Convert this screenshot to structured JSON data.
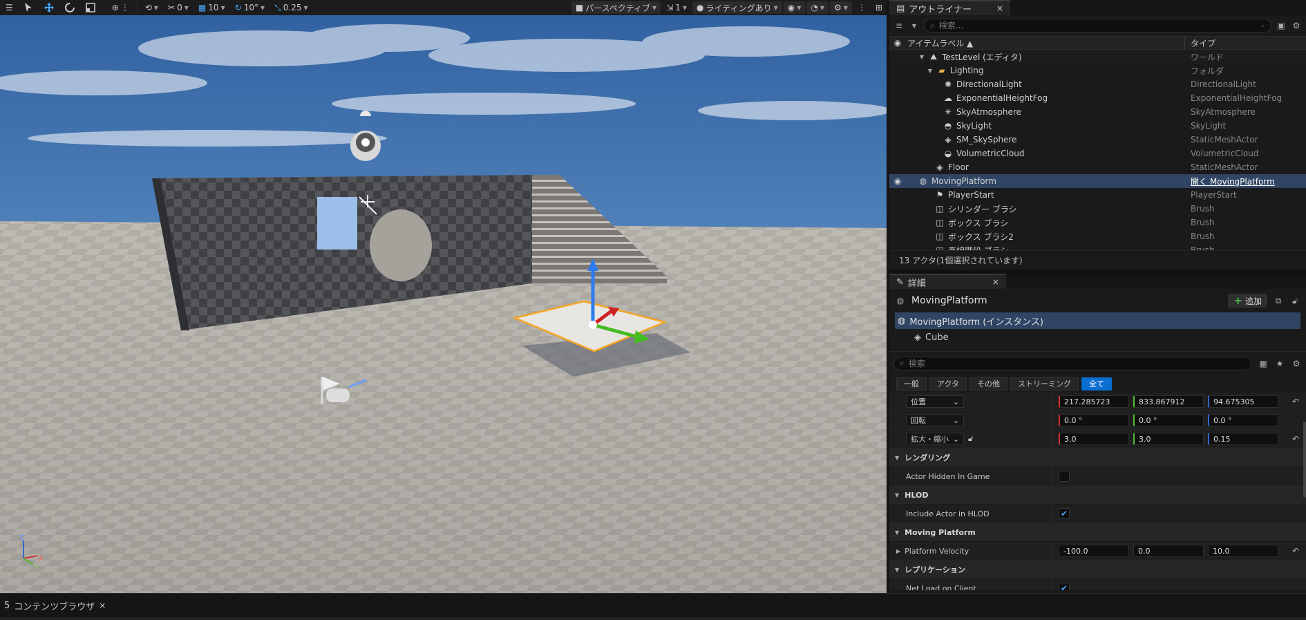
{
  "toolbar": {
    "snap_rotate_value": "0",
    "grid_snap_value": "10",
    "rotation_snap_value": "10°",
    "scale_snap_value": "0.25",
    "perspective_label": "パースペクティブ",
    "camera_speed_value": "1",
    "lighting_label": "ライティングあり"
  },
  "bottom": {
    "content_browser_label": "コンテンツブラウザ",
    "content_browser_prefix": "5",
    "close_glyph": "×"
  },
  "outliner": {
    "tab_label": "アウトライナー",
    "close_glyph": "×",
    "search_placeholder": "検索...",
    "header_label": "アイテムラベル ▲",
    "header_type": "タイプ",
    "rows": [
      {
        "label": "TestLevel (エディタ)",
        "type": "ワールド"
      },
      {
        "label": "Lighting",
        "type": "フォルダ"
      },
      {
        "label": "DirectionalLight",
        "type": "DirectionalLight"
      },
      {
        "label": "ExponentialHeightFog",
        "type": "ExponentialHeightFog"
      },
      {
        "label": "SkyAtmosphere",
        "type": "SkyAtmosphere"
      },
      {
        "label": "SkyLight",
        "type": "SkyLight"
      },
      {
        "label": "SM_SkySphere",
        "type": "StaticMeshActor"
      },
      {
        "label": "VolumetricCloud",
        "type": "VolumetricCloud"
      },
      {
        "label": "Floor",
        "type": "StaticMeshActor"
      },
      {
        "label": "MovingPlatform",
        "type": "開く MovingPlatform"
      },
      {
        "label": "PlayerStart",
        "type": "PlayerStart"
      },
      {
        "label": "シリンダー ブラシ",
        "type": "Brush"
      },
      {
        "label": "ボックス ブラシ",
        "type": "Brush"
      },
      {
        "label": "ボックス ブラシ2",
        "type": "Brush"
      },
      {
        "label": "直線階段 ブラシ",
        "type": "Brush"
      }
    ],
    "status": "13 アクタ(1個選択されています)"
  },
  "details": {
    "tab_label": "詳細",
    "close_glyph": "×",
    "actor_name": "MovingPlatform",
    "add_label": "追加",
    "instance_label": "MovingPlatform (インスタンス)",
    "component_cube": "Cube",
    "search_placeholder": "検索",
    "filters": [
      "一般",
      "アクタ",
      "その他",
      "ストリーミング",
      "全て"
    ],
    "location_label": "位置",
    "location": [
      "217.285723",
      "833.867912",
      "94.675305"
    ],
    "rotation_label": "回転",
    "rotation": [
      "0.0 °",
      "0.0 °",
      "0.0 °"
    ],
    "scale_label": "拡大・縮小",
    "scale": [
      "3.0",
      "3.0",
      "0.15"
    ],
    "cat_rendering": "レンダリング",
    "actor_hidden_label": "Actor Hidden In Game",
    "cat_hlod": "HLOD",
    "include_hlod_label": "Include Actor in HLOD",
    "cat_moving": "Moving Platform",
    "platform_velocity_label": "Platform Velocity",
    "platform_velocity": [
      "-100.0",
      "0.0",
      "10.0"
    ],
    "cat_replication": "レプリケーション",
    "net_load_label": "Net Load on Client"
  },
  "axes": {
    "z": "Z",
    "x": "X",
    "y": "Y"
  },
  "colors": {
    "selection": "#304563",
    "accent_blue": "#0a6ed0",
    "add_green": "#4bc34b",
    "axis_x": "#cc3333",
    "axis_y": "#55bb33",
    "axis_z": "#3366cc"
  }
}
